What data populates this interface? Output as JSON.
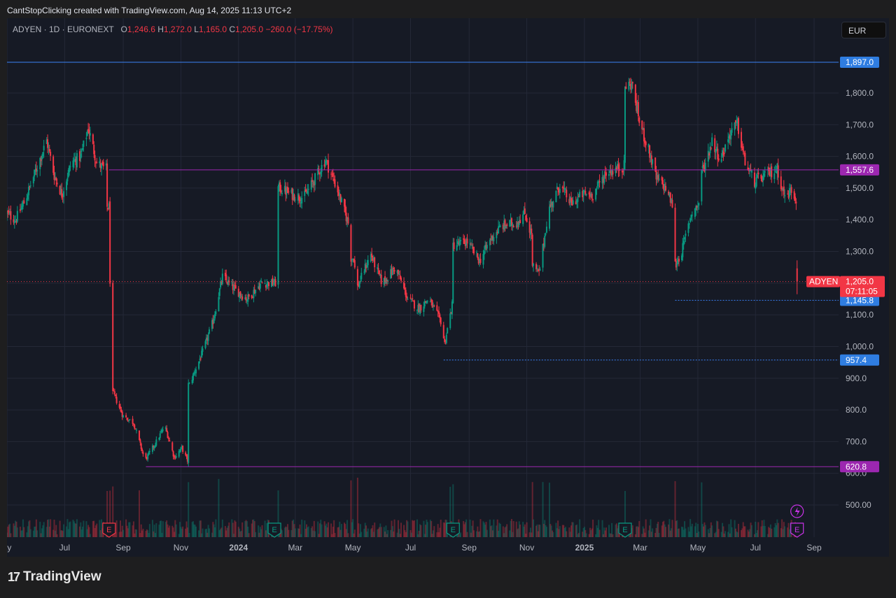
{
  "credit": "CantStopClicking created with TradingView.com, Aug 14, 2025 11:13 UTC+2",
  "legend": {
    "symbol": "ADYEN · 1D · EURONEXT",
    "o_label": "O",
    "o": "1,246.6",
    "h_label": "H",
    "h": "1,272.0",
    "l_label": "L",
    "l": "1,165.0",
    "c_label": "C",
    "c": "1,205.0",
    "change": "−260.0 (−17.75%)"
  },
  "currency": "EUR",
  "footer_logo": "TradingView",
  "colors": {
    "background": "#161a25",
    "grid": "#242837",
    "up": "#089981",
    "down": "#f23645",
    "hline_blue": "#3b82f6",
    "hline_purple": "#9c27b0",
    "price_label_red": "#f23645",
    "label_blue": "#2f7de1"
  },
  "chart_data": {
    "type": "candlestick",
    "symbol": "ADYEN",
    "interval": "1D",
    "exchange": "EURONEXT",
    "currency": "EUR",
    "y_ticks": [
      500,
      600,
      700,
      800,
      900,
      1000,
      1100,
      1200,
      1300,
      1400,
      1500,
      1600,
      1700,
      1800
    ],
    "y_tick_labels": [
      "500.00",
      "600.0",
      "700.0",
      "800.0",
      "900.0",
      "1,000.0",
      "1,100.0",
      "1,200.0",
      "1,300.0",
      "1,400.0",
      "1,500.0",
      "1,600.0",
      "1,700.0",
      "1,800.0"
    ],
    "ylim": [
      480,
      2000
    ],
    "x_ticks": [
      {
        "date": "2023-05-01",
        "label": "ay",
        "bold": false
      },
      {
        "date": "2023-07-01",
        "label": "Jul",
        "bold": false
      },
      {
        "date": "2023-09-01",
        "label": "Sep",
        "bold": false
      },
      {
        "date": "2023-11-01",
        "label": "Nov",
        "bold": false
      },
      {
        "date": "2024-01-01",
        "label": "2024",
        "bold": true
      },
      {
        "date": "2024-03-01",
        "label": "Mar",
        "bold": false
      },
      {
        "date": "2024-05-01",
        "label": "May",
        "bold": false
      },
      {
        "date": "2024-07-01",
        "label": "Jul",
        "bold": false
      },
      {
        "date": "2024-09-01",
        "label": "Sep",
        "bold": false
      },
      {
        "date": "2024-11-01",
        "label": "Nov",
        "bold": false
      },
      {
        "date": "2025-01-01",
        "label": "2025",
        "bold": true
      },
      {
        "date": "2025-03-01",
        "label": "Mar",
        "bold": false
      },
      {
        "date": "2025-05-01",
        "label": "May",
        "bold": false
      },
      {
        "date": "2025-07-01",
        "label": "Jul",
        "bold": false
      },
      {
        "date": "2025-09-01",
        "label": "Sep",
        "bold": false
      }
    ],
    "path_points": [
      [
        "2023-05-01",
        1420
      ],
      [
        "2023-05-10",
        1400
      ],
      [
        "2023-05-20",
        1460
      ],
      [
        "2023-06-01",
        1560
      ],
      [
        "2023-06-12",
        1650
      ],
      [
        "2023-06-20",
        1540
      ],
      [
        "2023-06-28",
        1480
      ],
      [
        "2023-07-08",
        1580
      ],
      [
        "2023-07-18",
        1600
      ],
      [
        "2023-07-26",
        1690
      ],
      [
        "2023-08-04",
        1580
      ],
      [
        "2023-08-12",
        1560
      ],
      [
        "2023-08-17",
        1440
      ],
      [
        "2023-08-18",
        1210
      ],
      [
        "2023-08-22",
        850
      ],
      [
        "2023-09-01",
        780
      ],
      [
        "2023-09-12",
        760
      ],
      [
        "2023-09-24",
        640
      ],
      [
        "2023-10-06",
        700
      ],
      [
        "2023-10-15",
        750
      ],
      [
        "2023-10-25",
        650
      ],
      [
        "2023-11-02",
        680
      ],
      [
        "2023-11-08",
        640
      ],
      [
        "2023-11-10",
        880
      ],
      [
        "2023-11-25",
        990
      ],
      [
        "2023-12-05",
        1080
      ],
      [
        "2023-12-15",
        1220
      ],
      [
        "2023-12-28",
        1180
      ],
      [
        "2024-01-10",
        1150
      ],
      [
        "2024-01-25",
        1200
      ],
      [
        "2024-02-10",
        1200
      ],
      [
        "2024-02-14",
        1500
      ],
      [
        "2024-02-26",
        1480
      ],
      [
        "2024-03-10",
        1470
      ],
      [
        "2024-03-22",
        1530
      ],
      [
        "2024-04-02",
        1590
      ],
      [
        "2024-04-14",
        1500
      ],
      [
        "2024-04-26",
        1390
      ],
      [
        "2024-05-02",
        1280
      ],
      [
        "2024-05-05",
        1180
      ],
      [
        "2024-05-14",
        1250
      ],
      [
        "2024-05-20",
        1290
      ],
      [
        "2024-06-01",
        1200
      ],
      [
        "2024-06-15",
        1250
      ],
      [
        "2024-06-28",
        1150
      ],
      [
        "2024-07-10",
        1120
      ],
      [
        "2024-07-20",
        1150
      ],
      [
        "2024-08-02",
        1080
      ],
      [
        "2024-08-06",
        1010
      ],
      [
        "2024-08-14",
        1130
      ],
      [
        "2024-08-16",
        1320
      ],
      [
        "2024-08-30",
        1330
      ],
      [
        "2024-09-12",
        1270
      ],
      [
        "2024-09-24",
        1340
      ],
      [
        "2024-10-05",
        1380
      ],
      [
        "2024-10-20",
        1390
      ],
      [
        "2024-10-30",
        1420
      ],
      [
        "2024-11-05",
        1360
      ],
      [
        "2024-11-08",
        1250
      ],
      [
        "2024-11-14",
        1230
      ],
      [
        "2024-11-24",
        1430
      ],
      [
        "2024-12-06",
        1510
      ],
      [
        "2024-12-18",
        1450
      ],
      [
        "2024-12-30",
        1480
      ],
      [
        "2025-01-10",
        1480
      ],
      [
        "2025-01-24",
        1550
      ],
      [
        "2025-02-04",
        1560
      ],
      [
        "2025-02-12",
        1570
      ],
      [
        "2025-02-13",
        1820
      ],
      [
        "2025-02-20",
        1830
      ],
      [
        "2025-03-01",
        1700
      ],
      [
        "2025-03-10",
        1620
      ],
      [
        "2025-03-18",
        1530
      ],
      [
        "2025-03-28",
        1500
      ],
      [
        "2025-04-05",
        1440
      ],
      [
        "2025-04-08",
        1260
      ],
      [
        "2025-04-14",
        1300
      ],
      [
        "2025-04-24",
        1420
      ],
      [
        "2025-05-02",
        1450
      ],
      [
        "2025-05-07",
        1560
      ],
      [
        "2025-05-16",
        1650
      ],
      [
        "2025-05-25",
        1590
      ],
      [
        "2025-06-05",
        1680
      ],
      [
        "2025-06-12",
        1700
      ],
      [
        "2025-06-20",
        1580
      ],
      [
        "2025-06-30",
        1520
      ],
      [
        "2025-07-12",
        1540
      ],
      [
        "2025-07-24",
        1560
      ],
      [
        "2025-08-01",
        1470
      ],
      [
        "2025-08-08",
        1495
      ],
      [
        "2025-08-13",
        1465
      ],
      [
        "2025-08-14",
        1205
      ]
    ],
    "last_candle": {
      "date": "2025-08-14",
      "open": 1246.6,
      "high": 1272.0,
      "low": 1165.0,
      "close": 1205.0
    },
    "horizontal_lines": [
      {
        "price": 1897.0,
        "label": "1,897.0",
        "style": "solid",
        "color": "#3b82f6",
        "start": "2023-05-01"
      },
      {
        "price": 1557.6,
        "label": "1,557.6",
        "style": "solid",
        "color": "#9c27b0",
        "start": "2023-08-17"
      },
      {
        "price": 620.8,
        "label": "620.8",
        "style": "solid",
        "color": "#9c27b0",
        "start": "2023-09-25"
      },
      {
        "price": 1145.8,
        "label": "1,145.8",
        "style": "dotted",
        "color": "#3b82f6",
        "start": "2025-04-07"
      },
      {
        "price": 957.4,
        "label": "957.4",
        "style": "dotted",
        "color": "#3b82f6",
        "start": "2024-08-05"
      }
    ],
    "current_price": {
      "price": 1205.0,
      "symbol": "ADYEN",
      "label": "1,205.0",
      "countdown": "07:11:05"
    },
    "earnings_markers": [
      {
        "date": "2023-08-17",
        "label": "E",
        "color": "#f23645"
      },
      {
        "date": "2024-02-08",
        "label": "E",
        "color": "#089981"
      },
      {
        "date": "2024-08-15",
        "label": "E",
        "color": "#089981"
      },
      {
        "date": "2025-02-13",
        "label": "E",
        "color": "#089981"
      },
      {
        "date": "2025-08-14",
        "label": "E",
        "color": "#c832e6"
      }
    ],
    "event_marker": {
      "date": "2025-08-14",
      "icon": "lightning-icon"
    }
  }
}
